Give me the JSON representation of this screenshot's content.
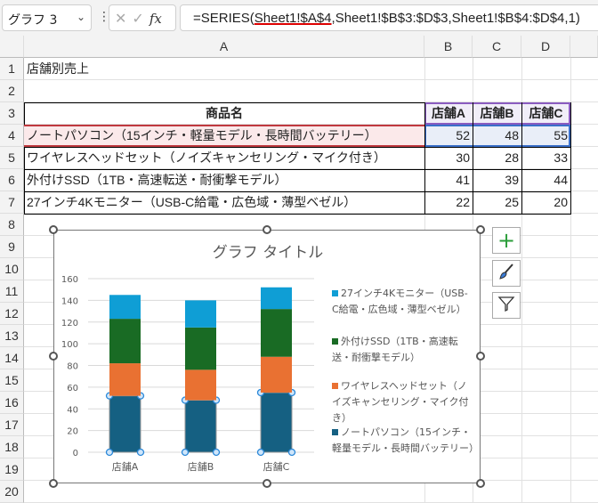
{
  "formula_bar": {
    "name_box": "グラフ 3",
    "cancel_icon": "x-icon",
    "enter_icon": "check-icon",
    "fx_label": "fx",
    "formula_prefix": "=SERIES(",
    "formula_ref": "Sheet1!$A$4",
    "formula_rest": ",Sheet1!$B$3:$D$3,Sheet1!$B$4:$D$4,1)"
  },
  "columns": [
    "A",
    "B",
    "C",
    "D"
  ],
  "rows": [
    "1",
    "2",
    "3",
    "4",
    "5",
    "6",
    "7",
    "8",
    "9",
    "10",
    "11",
    "12",
    "13",
    "14",
    "15",
    "16",
    "17",
    "18",
    "19",
    "20"
  ],
  "sheet": {
    "title": "店舗別売上",
    "header": [
      "商品名",
      "店舗A",
      "店舗B",
      "店舗C"
    ],
    "data": [
      [
        "ノートパソコン（15インチ・軽量モデル・長時間バッテリー）",
        "52",
        "48",
        "55"
      ],
      [
        "ワイヤレスヘッドセット（ノイズキャンセリング・マイク付き）",
        "30",
        "28",
        "33"
      ],
      [
        "外付けSSD（1TB・高速転送・耐衝撃モデル）",
        "41",
        "39",
        "44"
      ],
      [
        "27インチ4Kモニター（USB-C給電・広色域・薄型ベゼル）",
        "22",
        "25",
        "20"
      ]
    ]
  },
  "chart_buttons": [
    "plus-icon",
    "brush-icon",
    "filter-icon"
  ],
  "chart_data": {
    "type": "bar",
    "stacked": true,
    "title": "グラフ タイトル",
    "categories": [
      "店舗A",
      "店舗B",
      "店舗C"
    ],
    "ylim": [
      0,
      160
    ],
    "yticks": [
      "0",
      "20",
      "40",
      "60",
      "80",
      "100",
      "120",
      "140",
      "160"
    ],
    "grid": true,
    "legend_position": "right",
    "selected_series": 0,
    "series": [
      {
        "name": "ノートパソコン（15インチ・軽量モデル・長時間バッテリー）",
        "values": [
          52,
          48,
          55
        ],
        "color": "#156082"
      },
      {
        "name": "ワイヤレスヘッドセット（ノイズキャンセリング・マイク付き）",
        "values": [
          30,
          28,
          33
        ],
        "color": "#e97132"
      },
      {
        "name": "外付けSSD（1TB・高速転送・耐衝撃モデル）",
        "values": [
          41,
          39,
          44
        ],
        "color": "#196b24"
      },
      {
        "name": "27インチ4Kモニター（USB-C給電・広色域・薄型ベゼル）",
        "values": [
          22,
          25,
          20
        ],
        "color": "#0f9ed5"
      }
    ]
  }
}
